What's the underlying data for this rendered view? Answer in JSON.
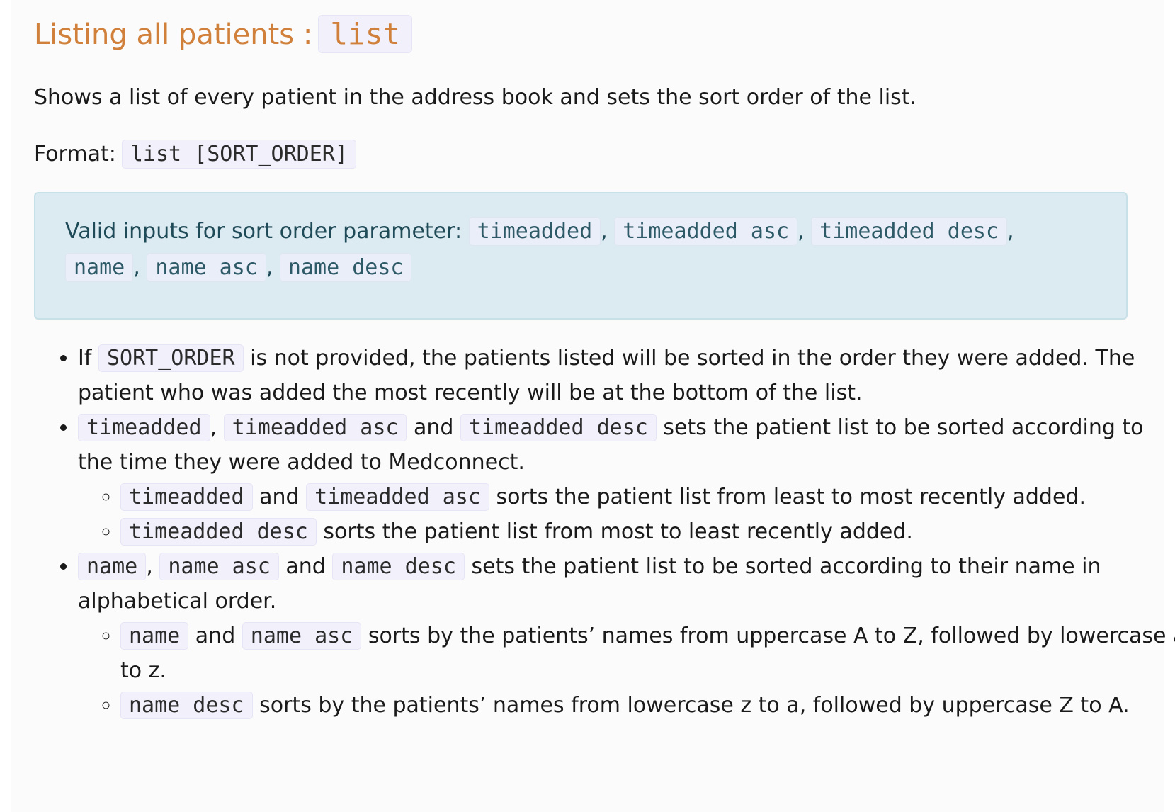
{
  "heading": {
    "text": "Listing all patients :",
    "command": "list"
  },
  "description": "Shows a list of every patient in the address book and sets the sort order of the list.",
  "format": {
    "label": "Format:",
    "syntax": "list [SORT_ORDER]"
  },
  "note": {
    "label": "Valid inputs for sort order parameter:",
    "options": [
      "timeadded",
      "timeadded asc",
      "timeadded desc",
      "name",
      "name asc",
      "name desc"
    ]
  },
  "bullets": {
    "b1": {
      "pre": "If",
      "code": "SORT_ORDER",
      "post": "is not provided, the patients listed will be sorted in the order they were added. The patient who was added the most recently will be at the bottom of the list."
    },
    "b2": {
      "code1": "timeadded",
      "code2": "timeadded asc",
      "and": "and",
      "code3": "timeadded desc",
      "post": "sets the patient list to be sorted according to the time they were added to Medconnect.",
      "sub1": {
        "code1": "timeadded",
        "and": "and",
        "code2": "timeadded asc",
        "post": "sorts the patient list from least to most recently added."
      },
      "sub2": {
        "code": "timeadded desc",
        "post": "sorts the patient list from most to least recently added."
      }
    },
    "b3": {
      "code1": "name",
      "code2": "name asc",
      "and": "and",
      "code3": "name desc",
      "post": "sets the patient list to be sorted according to their name in alphabetical order.",
      "sub1": {
        "code1": "name",
        "and": "and",
        "code2": "name asc",
        "post": "sorts by the patients’ names from uppercase A to Z, followed by lowercase a to z."
      },
      "sub2": {
        "code": "name desc",
        "post": "sorts by the patients’ names from lowercase z to a, followed by uppercase Z to A."
      }
    }
  }
}
